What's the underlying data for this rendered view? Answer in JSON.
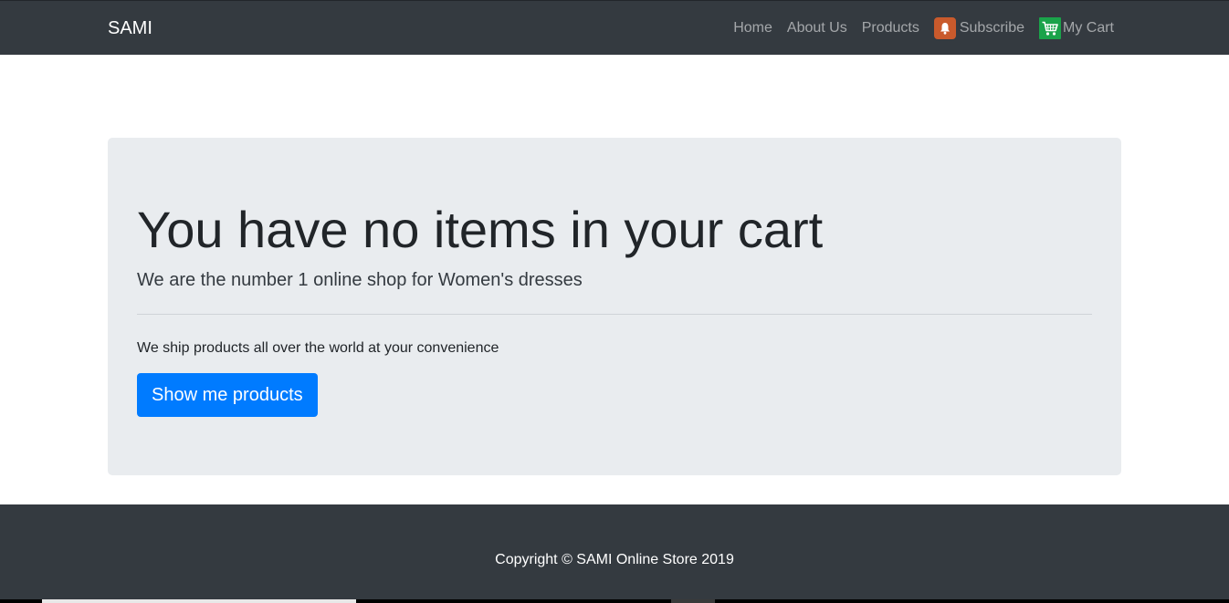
{
  "navbar": {
    "brand": "SAMI",
    "links": [
      {
        "label": "Home"
      },
      {
        "label": "About Us"
      },
      {
        "label": "Products"
      },
      {
        "label": "Subscribe",
        "icon": "bell-icon"
      },
      {
        "label": "My Cart",
        "icon": "shopping-cart-icon"
      }
    ]
  },
  "hero": {
    "heading": "You have no items in your cart",
    "lead": "We are the number 1 online shop for Women's dresses",
    "body": "We ship products all over the world at your convenience",
    "button_label": "Show me products"
  },
  "footer": {
    "copyright": "Copyright © SAMI Online Store 2019"
  },
  "colors": {
    "navbar_bg": "#343a40",
    "jumbotron_bg": "#e9ecef",
    "primary": "#007bff",
    "subscribe_icon": "#c95a2c",
    "cart_icon": "#1aa34a"
  }
}
